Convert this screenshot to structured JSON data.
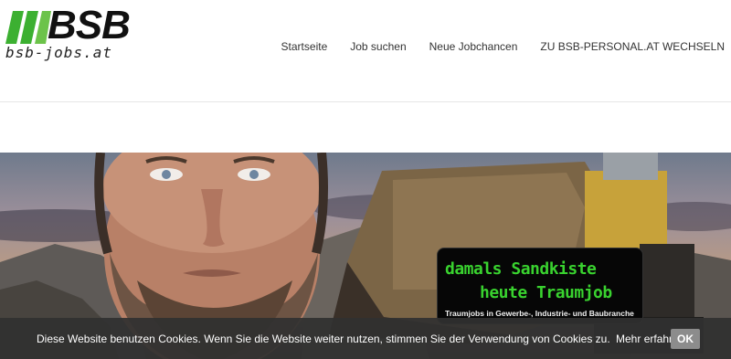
{
  "brand": {
    "name": "BSB",
    "subtitle": "bsb-jobs.at",
    "bar_color": "#3cb031"
  },
  "nav": {
    "items": [
      {
        "label": "Startseite"
      },
      {
        "label": "Job suchen"
      },
      {
        "label": "Neue Jobchancen"
      },
      {
        "label": "ZU BSB-PERSONAL.AT WECHSELN"
      }
    ]
  },
  "hero": {
    "promo": {
      "line1": "damals Sandkiste",
      "line2": "heute Traumjob",
      "line3": "Traumjobs in Gewerbe-, Industrie- und Baubranche",
      "accent_color": "#39d22f"
    }
  },
  "cookie_bar": {
    "text": "Diese Website benutzen Cookies. Wenn Sie die Website weiter nutzen, stimmen Sie der Verwendung von Cookies zu.",
    "link_label": "Mehr erfahren",
    "ok_label": "OK"
  }
}
